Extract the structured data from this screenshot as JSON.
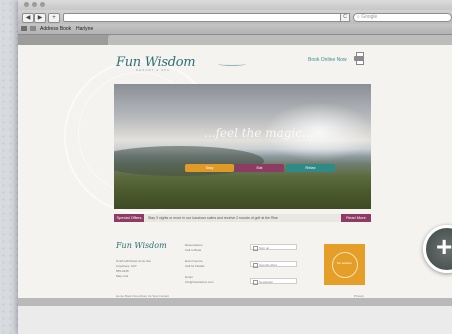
{
  "browser": {
    "back": "◀",
    "forward": "▶",
    "add": "+",
    "reload": "C",
    "search_placeholder": "Google",
    "bookmarks": [
      "Address Book",
      "Harlyne"
    ]
  },
  "site": {
    "logo": "Fun Wisdom",
    "logo_sub": "RESORT & SPA",
    "book_link": "Book Online Now",
    "hero_text": "...feel the magic...",
    "hero_buttons": [
      "Stay",
      "Eat",
      "Relax"
    ],
    "news_label": "Special Offers",
    "news_text": "Stay 3 nights or more in our luxurious suites and receive 2 rounds of golf at the Rise",
    "news_more": "Read More",
    "footer_logo": "Fun Wisdom",
    "footer_address": [
      "Smith Hill Road, Anne Ave",
      "Anywhere, ACT",
      "555-0135",
      "Map Link"
    ],
    "footer_cols": [
      [
        "Reservations",
        "Call to Book"
      ],
      [
        "Event Centre",
        "Call for Details"
      ],
      [
        "Email",
        "info@funwisdom.com"
      ]
    ],
    "checkboxes": [
      "Sign up",
      "Special offers",
      "Newsletter"
    ],
    "badge_text": "fun wisdom",
    "footer_nav": "Home  Book Now  About Us  Spa  Contact",
    "footer_right": "Privacy"
  },
  "colors": {
    "accent_teal": "#2e8a86",
    "accent_orange": "#e09a25",
    "accent_plum": "#8d3b63"
  },
  "icons": [
    "print-icon",
    "zoom-plus-icon"
  ]
}
